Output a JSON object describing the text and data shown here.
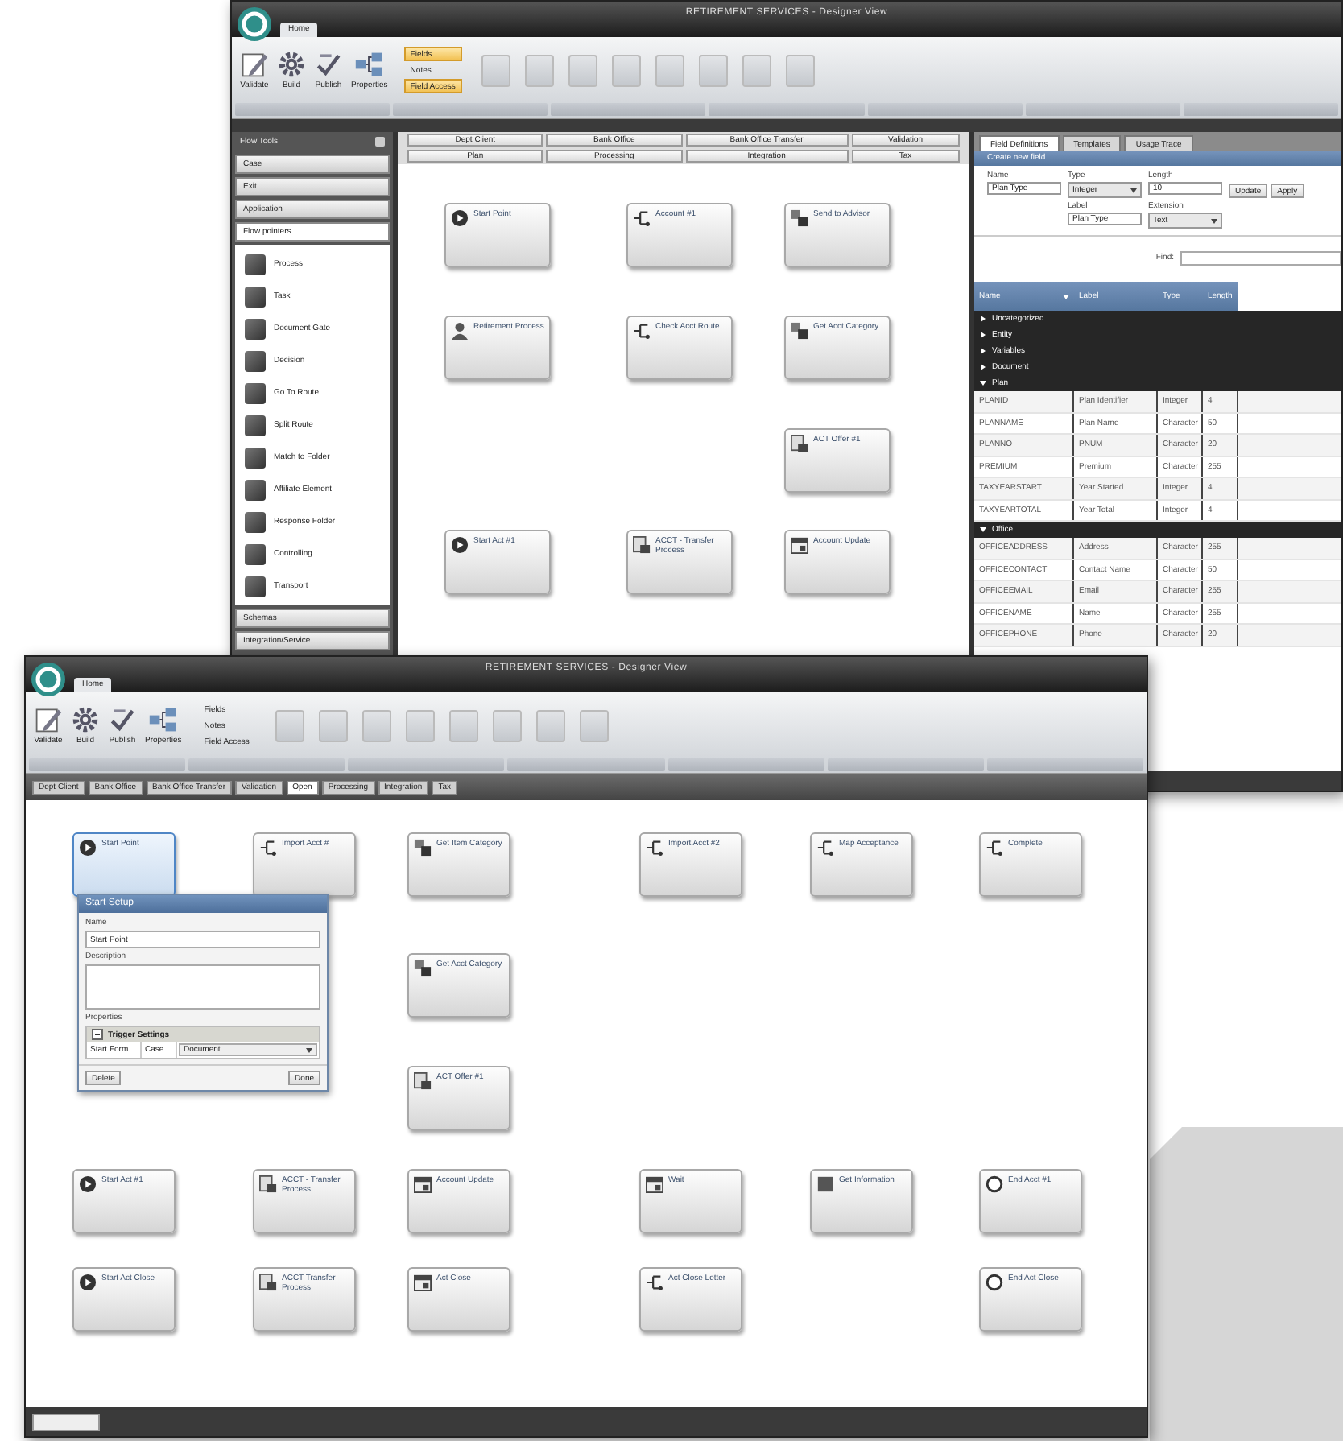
{
  "back_window": {
    "title": "RETIREMENT SERVICES - Designer View",
    "ribbon_tab": "Home",
    "ribbon_buttons": [
      {
        "label": "Validate",
        "kind": "pencil"
      },
      {
        "label": "Build",
        "kind": "gear"
      },
      {
        "label": "Publish",
        "kind": "check"
      },
      {
        "label": "Properties",
        "kind": "diagram"
      }
    ],
    "ribbon_small": [
      {
        "label": "Fields",
        "selected": true
      },
      {
        "label": "Notes",
        "selected": false
      },
      {
        "label": "Field Access",
        "selected": true
      }
    ],
    "sidebar": {
      "title": "Flow Tools",
      "sections_top": [
        {
          "label": "Case",
          "expanded": false
        },
        {
          "label": "Exit",
          "expanded": false
        },
        {
          "label": "Application",
          "expanded": false
        },
        {
          "label": "Flow pointers",
          "expanded": true
        }
      ],
      "items": [
        "Process",
        "Task",
        "Document Gate",
        "Decision",
        "Go To Route",
        "Split Route",
        "Match to Folder",
        "Affiliate Element",
        "Response Folder",
        "Controlling",
        "Transport"
      ],
      "sections_bottom": [
        {
          "label": "Schemas",
          "expanded": false
        },
        {
          "label": "Integration/Service",
          "expanded": false
        }
      ]
    },
    "filters": [
      {
        "label": "Dept Client"
      },
      {
        "label": "Bank Office"
      },
      {
        "label": "Bank Office Transfer"
      },
      {
        "label": "Validation"
      },
      {
        "label": "Plan"
      },
      {
        "label": "Processing"
      },
      {
        "label": "Integration"
      },
      {
        "label": "Tax"
      }
    ],
    "nodes": [
      {
        "label": "Start Point",
        "kind": "start"
      },
      {
        "label": "Account #1",
        "kind": "route"
      },
      {
        "label": "Send to Advisor",
        "kind": "task"
      },
      {
        "label": "Retirement Process",
        "kind": "form"
      },
      {
        "label": "Check Acct Route",
        "kind": "route"
      },
      {
        "label": "Get Acct Category",
        "kind": "task"
      },
      {
        "label": "ACT Offer #1",
        "kind": "doc"
      },
      {
        "label": "Start Act #1",
        "kind": "start"
      },
      {
        "label": "ACCT - Transfer Process",
        "kind": "doc"
      },
      {
        "label": "Account Update",
        "kind": "wait"
      }
    ],
    "right_panel": {
      "tabs": [
        {
          "label": "Field Definitions",
          "selected": true
        },
        {
          "label": "Templates",
          "selected": false
        },
        {
          "label": "Usage Trace",
          "selected": false
        }
      ],
      "form_title": "Create new field",
      "fields": [
        {
          "label": "Name",
          "value": "Plan Type",
          "kind": "text"
        },
        {
          "label": "Type",
          "value": "Integer",
          "kind": "select"
        },
        {
          "label": "Length",
          "value": "10",
          "kind": "text"
        },
        {
          "label": "Label",
          "value": "Plan Type",
          "kind": "text"
        },
        {
          "label": "Extension",
          "value": "Text",
          "kind": "select"
        }
      ],
      "buttons": [
        "Update",
        "Apply"
      ],
      "find_label": "Find:",
      "columns": [
        "Name",
        "Label",
        "Type",
        "Length"
      ],
      "groups": [
        {
          "name": "Uncategorized",
          "expanded": false
        },
        {
          "name": "Entity",
          "expanded": false
        },
        {
          "name": "Variables",
          "expanded": false
        },
        {
          "name": "Document",
          "expanded": false
        },
        {
          "name": "Plan",
          "expanded": true,
          "rows": [
            [
              "PLANID",
              "Plan Identifier",
              "Integer",
              "4"
            ],
            [
              "PLANNAME",
              "Plan Name",
              "Character",
              "50"
            ],
            [
              "PLANNO",
              "PNUM",
              "Character",
              "20"
            ],
            [
              "PREMIUM",
              "Premium",
              "Character",
              "255"
            ],
            [
              "TAXYEARSTART",
              "Year Started",
              "Integer",
              "4"
            ],
            [
              "TAXYEARTOTAL",
              "Year Total",
              "Integer",
              "4"
            ]
          ]
        },
        {
          "name": "Office",
          "expanded": true,
          "rows": [
            [
              "OFFICEADDRESS",
              "Address",
              "Character",
              "255"
            ],
            [
              "OFFICECONTACT",
              "Contact Name",
              "Character",
              "50"
            ],
            [
              "OFFICEEMAIL",
              "Email",
              "Character",
              "255"
            ],
            [
              "OFFICENAME",
              "Name",
              "Character",
              "255"
            ],
            [
              "OFFICEPHONE",
              "Phone",
              "Character",
              "20"
            ]
          ]
        }
      ]
    }
  },
  "front_window": {
    "title": "RETIREMENT SERVICES - Designer View",
    "ribbon_tab": "Home",
    "ribbon_buttons": [
      {
        "label": "Validate",
        "kind": "pencil"
      },
      {
        "label": "Build",
        "kind": "gear"
      },
      {
        "label": "Publish",
        "kind": "check"
      },
      {
        "label": "Properties",
        "kind": "diagram"
      }
    ],
    "ribbon_small": [
      {
        "label": "Fields",
        "selected": false
      },
      {
        "label": "Notes",
        "selected": false
      },
      {
        "label": "Field Access",
        "selected": false
      }
    ],
    "filters": [
      {
        "label": "Dept Client",
        "selected": false
      },
      {
        "label": "Bank Office",
        "selected": false
      },
      {
        "label": "Bank Office Transfer",
        "selected": false
      },
      {
        "label": "Validation",
        "selected": false
      },
      {
        "label": "Open",
        "selected": true
      },
      {
        "label": "Processing",
        "selected": false
      },
      {
        "label": "Integration",
        "selected": false
      },
      {
        "label": "Tax",
        "selected": false
      }
    ],
    "nodes": [
      {
        "label": "Start Point",
        "kind": "start",
        "selected": true
      },
      {
        "label": "Import Acct #",
        "kind": "route",
        "selected": false
      },
      {
        "label": "Get Item Category",
        "kind": "task",
        "selected": false
      },
      {
        "label": "Import Acct #2",
        "kind": "route",
        "selected": false
      },
      {
        "label": "Map Acceptance",
        "kind": "route",
        "selected": false
      },
      {
        "label": "Complete",
        "kind": "route",
        "selected": false
      },
      {
        "label": "Get Acct Category",
        "kind": "task",
        "selected": false
      },
      {
        "label": "ACT Offer #1",
        "kind": "doc",
        "selected": false
      },
      {
        "label": "Start Act #1",
        "kind": "start",
        "selected": false
      },
      {
        "label": "ACCT - Transfer Process",
        "kind": "doc",
        "selected": false
      },
      {
        "label": "Account Update",
        "kind": "wait",
        "selected": false
      },
      {
        "label": "Wait",
        "kind": "wait",
        "selected": false
      },
      {
        "label": "Get Information",
        "kind": "info",
        "selected": false
      },
      {
        "label": "End Acct #1",
        "kind": "end",
        "selected": false
      },
      {
        "label": "Start Act Close",
        "kind": "start",
        "selected": false
      },
      {
        "label": "ACCT Transfer Process",
        "kind": "doc",
        "selected": false
      },
      {
        "label": "Act Close",
        "kind": "wait",
        "selected": false
      },
      {
        "label": "Act Close Letter",
        "kind": "route",
        "selected": false
      },
      {
        "label": "End Act Close",
        "kind": "end",
        "selected": false
      }
    ],
    "dialog": {
      "title": "Start Setup",
      "name_label": "Name",
      "name_value": "Start Point",
      "description_label": "Description",
      "properties_label": "Properties",
      "category": "Trigger Settings",
      "category_expanded": true,
      "property": [
        "Start Form",
        "Case",
        "Document"
      ],
      "buttons": [
        "Delete",
        "Done"
      ]
    }
  }
}
